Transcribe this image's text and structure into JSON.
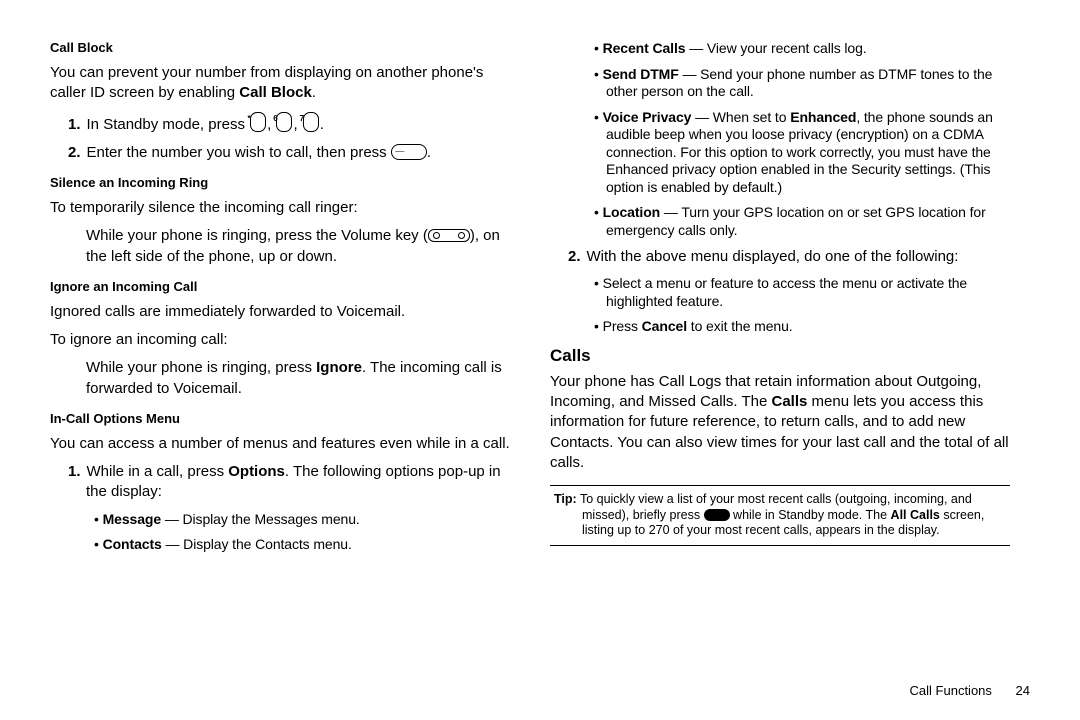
{
  "left": {
    "callBlock": {
      "head": "Call Block",
      "p1a": "You can prevent your number from displaying on another phone's caller ID screen by enabling ",
      "p1b": "Call Block",
      "p1c": ".",
      "step1a": "In Standby mode, press ",
      "step1b": ", ",
      "step1c": ", ",
      "step1d": ".",
      "step2a": "Enter the number you wish to call, then press ",
      "step2b": "."
    },
    "silence": {
      "head": "Silence an Incoming Ring",
      "p1": "To temporarily silence the incoming call ringer:",
      "p2a": "While your phone is ringing, press the Volume key (",
      "p2b": "), on the left side of the phone, up or down."
    },
    "ignore": {
      "head": "Ignore an Incoming Call",
      "p1": "Ignored calls are immediately forwarded to Voicemail.",
      "p2": "To ignore an incoming call:",
      "p3a": "While your phone is ringing, press ",
      "p3b": "Ignore",
      "p3c": ". The incoming call is forwarded to Voicemail."
    },
    "inCall": {
      "head": "In-Call Options Menu",
      "p1": "You can access a number of menus and features even while in a call.",
      "step1a": "While in a call, press ",
      "step1b": "Options",
      "step1c": ". The following options pop-up in the display:",
      "b1a": "Message",
      "b1b": " — Display the Messages menu.",
      "b2a": "Contacts",
      "b2b": " — Display the Contacts menu."
    }
  },
  "right": {
    "bullets": {
      "b3a": "Recent Calls",
      "b3b": " — View your recent calls log.",
      "b4a": "Send DTMF",
      "b4b": " — Send your phone number as DTMF tones to the other person on the call.",
      "b5a": "Voice Privacy",
      "b5b": " — When set to ",
      "b5c": "Enhanced",
      "b5d": ", the phone sounds an audible beep when you loose privacy (encryption) on a CDMA connection. For this option to work correctly, you must have the Enhanced privacy option enabled in the Security settings. (This option is enabled by default.)",
      "b6a": "Location",
      "b6b": " — Turn your GPS location on or set GPS location for emergency calls only."
    },
    "step2": "With the above menu displayed, do one of the following:",
    "sub1": "Select a menu or feature to access the menu or activate the highlighted feature.",
    "sub2a": "Press ",
    "sub2b": "Cancel",
    "sub2c": " to exit the menu.",
    "calls": {
      "head": "Calls",
      "p1a": "Your phone has Call Logs that retain information about Outgoing, Incoming, and Missed Calls. The ",
      "p1b": "Calls",
      "p1c": " menu lets you access this information for future reference, to return calls, and to add new Contacts. You can also view times for your last call and the total of all calls."
    },
    "tip": {
      "label": "Tip:",
      "t1": "To quickly view a list of your most recent calls (outgoing, incoming, and missed), briefly press ",
      "t2": " while in Standby mode. The ",
      "t3": "All Calls",
      "t4": " screen, listing up to 270 of your most recent calls, appears in the display."
    }
  },
  "footer": {
    "section": "Call Functions",
    "page": "24"
  }
}
